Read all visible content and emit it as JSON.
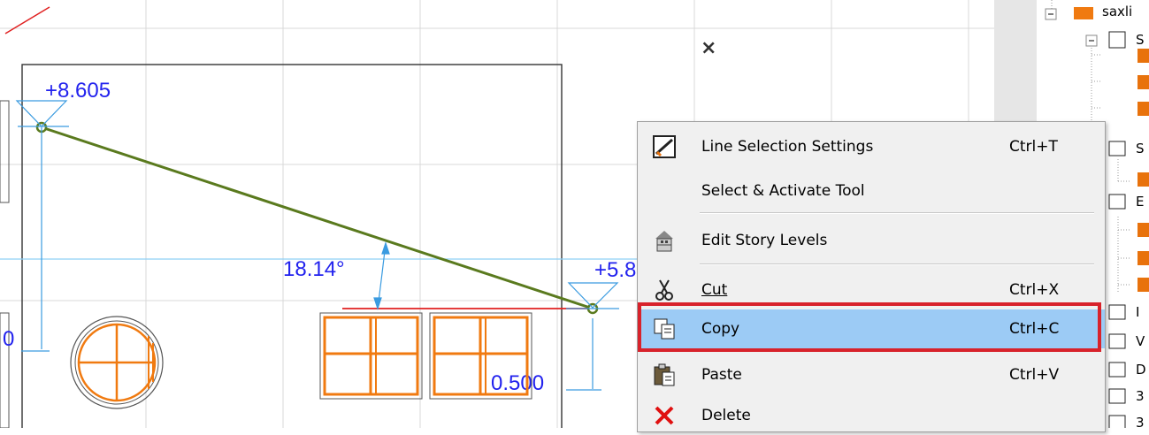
{
  "drawing": {
    "close_glyph": "×",
    "elevation_top": "+8.605",
    "elevation_right": "+5.8",
    "angle": "18.14°",
    "dim_offset": "0.500",
    "dim_left": "0"
  },
  "context_menu": {
    "items": [
      {
        "label": "Line Selection Settings",
        "shortcut": "Ctrl+T",
        "icon": "line-settings-icon"
      },
      {
        "label": "Select & Activate Tool",
        "shortcut": "",
        "icon": ""
      },
      {
        "label": "Edit Story Levels",
        "shortcut": "",
        "icon": "story-levels-icon"
      },
      {
        "label": "Cut",
        "shortcut": "Ctrl+X",
        "icon": "scissors-icon"
      },
      {
        "label": "Copy",
        "shortcut": "Ctrl+C",
        "icon": "copy-icon"
      },
      {
        "label": "Paste",
        "shortcut": "Ctrl+V",
        "icon": "paste-icon"
      },
      {
        "label": "Delete",
        "shortcut": "",
        "icon": "delete-x-icon"
      }
    ],
    "highlighted": "Copy",
    "highlight_color": "#9ccbf5",
    "callout_color": "#d8222b"
  },
  "tree": {
    "root_label": "saxli",
    "nodes": [
      "S",
      "S",
      "E",
      "I",
      "V",
      "D",
      "3",
      "3"
    ]
  },
  "colors": {
    "dimension": "#2222ee",
    "roof_line": "#5a7a1e",
    "window": "#f07a10",
    "red_line": "#e02020"
  }
}
